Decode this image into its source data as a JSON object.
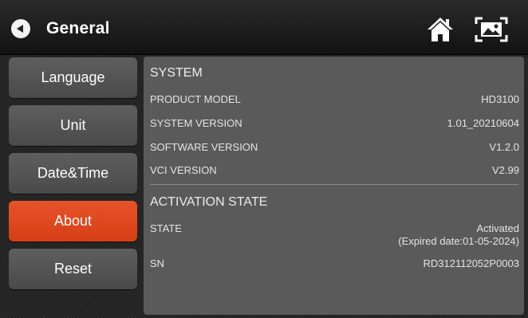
{
  "header": {
    "title": "General",
    "back_icon": "back-arrow-icon",
    "home_icon": "home-icon",
    "screenshot_icon": "screenshot-icon"
  },
  "sidebar": {
    "items": [
      {
        "label": "Language",
        "active": false
      },
      {
        "label": "Unit",
        "active": false
      },
      {
        "label": "Date&Time",
        "active": false
      },
      {
        "label": "About",
        "active": true
      },
      {
        "label": "Reset",
        "active": false
      }
    ]
  },
  "about": {
    "system_title": "SYSTEM",
    "system_rows": [
      {
        "label": "PRODUCT MODEL",
        "value": "HD3100"
      },
      {
        "label": "SYSTEM VERSION",
        "value": "1.01_20210604"
      },
      {
        "label": "SOFTWARE VERSION",
        "value": "V1.2.0"
      },
      {
        "label": "VCI VERSION",
        "value": "V2.99"
      }
    ],
    "activation_title": "ACTIVATION STATE",
    "state_label": "STATE",
    "state_value": "Activated",
    "state_expiry": "(Expired date:01-05-2024)",
    "sn_label": "SN",
    "sn_value": "RD312112052P0003"
  },
  "colors": {
    "accent": "#e04a20",
    "panel": "#5a5a5a",
    "button": "#555555"
  }
}
